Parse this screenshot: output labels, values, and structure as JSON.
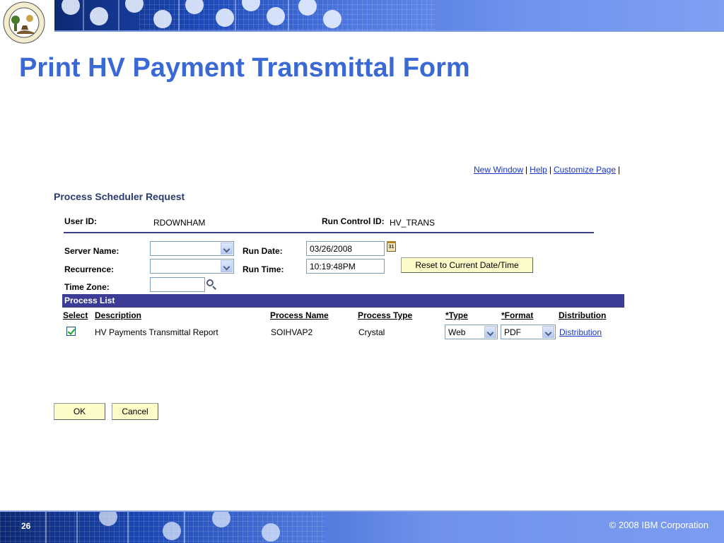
{
  "slide": {
    "title": "Print HV Payment Transmittal Form",
    "page_number": "26",
    "copyright": "© 2008 IBM Corporation"
  },
  "seal": {
    "icon": "state-seal-icon",
    "text": "SEAL OF THE STATE OF INDIANA 1816"
  },
  "top_links": {
    "new_window": "New Window",
    "help": "Help",
    "customize_page": "Customize Page",
    "separator": "|"
  },
  "form": {
    "heading": "Process Scheduler Request",
    "user_id_label": "User ID:",
    "user_id_value": "RDOWNHAM",
    "run_control_label": "Run Control ID:",
    "run_control_value": "HV_TRANS",
    "server_name_label": "Server Name:",
    "server_name_value": "",
    "recurrence_label": "Recurrence:",
    "recurrence_value": "",
    "time_zone_label": "Time Zone:",
    "time_zone_value": "",
    "run_date_label": "Run Date:",
    "run_date_value": "03/26/2008",
    "run_time_label": "Run Time:",
    "run_time_value": "10:19:48PM",
    "reset_button": "Reset to Current Date/Time",
    "calendar_icon_text": "31"
  },
  "process_list": {
    "title": "Process List",
    "columns": [
      "Select",
      "Description",
      "Process Name",
      "Process Type",
      "*Type",
      "*Format",
      "Distribution"
    ],
    "rows": [
      {
        "selected": true,
        "description": "HV Payments Transmittal Report",
        "process_name": "SOIHVAP2",
        "process_type": "Crystal",
        "type": "Web",
        "format": "PDF",
        "distribution": "Distribution"
      }
    ]
  },
  "actions": {
    "ok": "OK",
    "cancel": "Cancel"
  },
  "colors": {
    "title": "#3a69d6",
    "link": "#1a36c8",
    "process_bar": "#3a3c95",
    "button_bg": "#fdfbc8"
  }
}
